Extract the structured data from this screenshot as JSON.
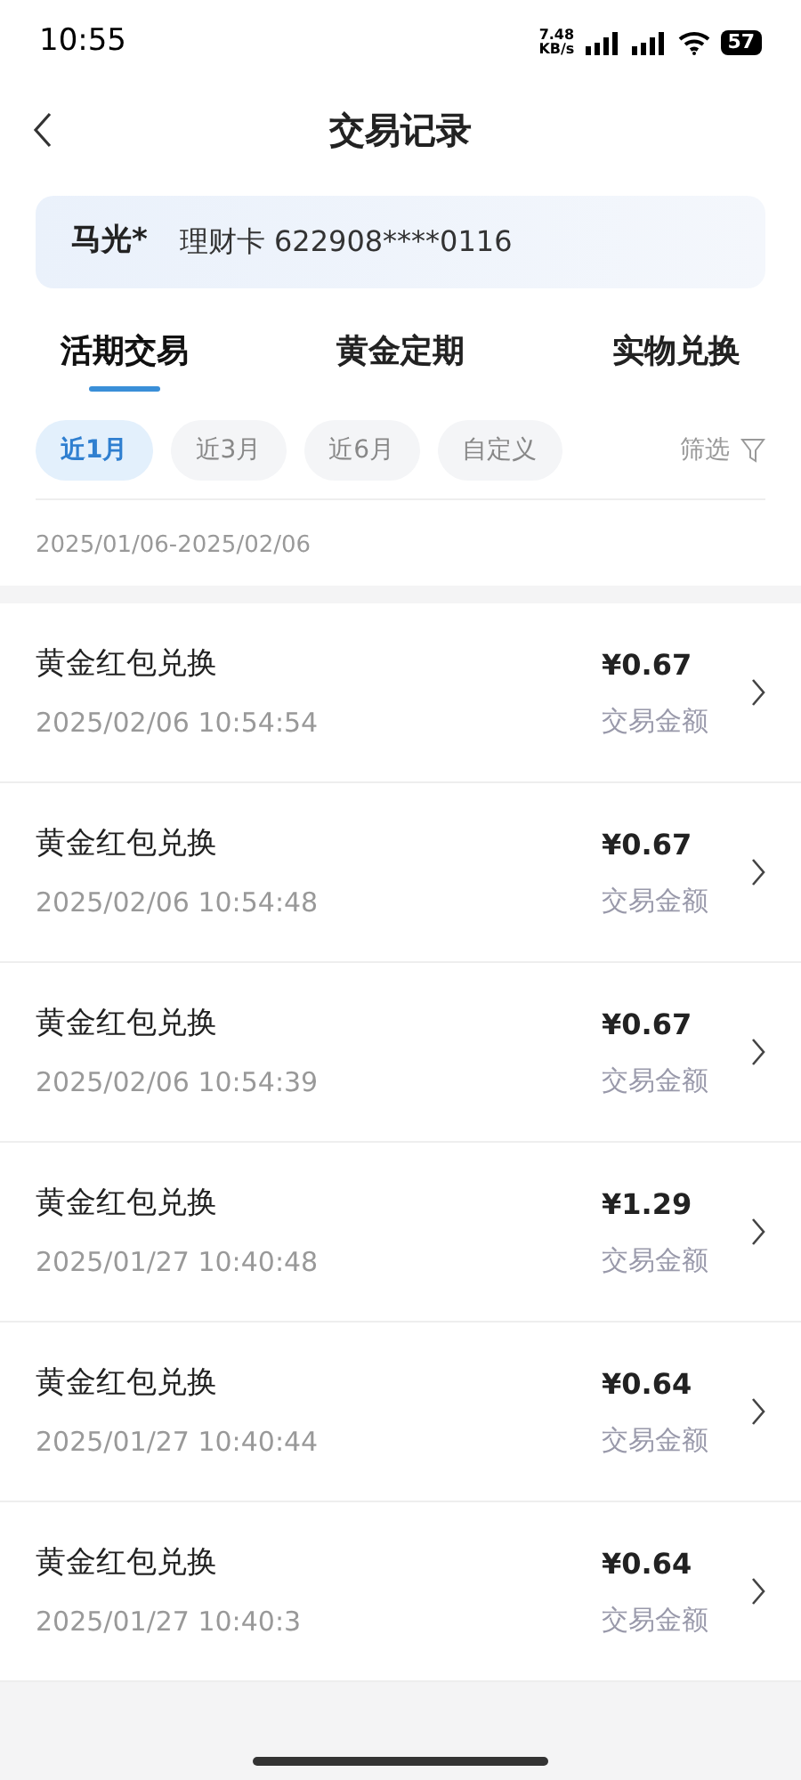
{
  "status_bar": {
    "time": "10:55",
    "speed": "7.48",
    "speed_unit": "KB/s",
    "battery": "57"
  },
  "header": {
    "title": "交易记录"
  },
  "account": {
    "name": "马光*",
    "card": "理财卡 622908****0116"
  },
  "tabs": [
    {
      "label": "活期交易",
      "selected": true
    },
    {
      "label": "黄金定期",
      "selected": false
    },
    {
      "label": "实物兑换",
      "selected": false
    }
  ],
  "periods": [
    {
      "label": "近1月",
      "selected": true
    },
    {
      "label": "近3月",
      "selected": false
    },
    {
      "label": "近6月",
      "selected": false
    },
    {
      "label": "自定义",
      "selected": false
    }
  ],
  "filter": {
    "label": "筛选"
  },
  "date_range": "2025/01/06-2025/02/06",
  "transactions": [
    {
      "title": "黄金红包兑换",
      "time": "2025/02/06 10:54:54",
      "amount": "¥0.67",
      "amount_label": "交易金额"
    },
    {
      "title": "黄金红包兑换",
      "time": "2025/02/06 10:54:48",
      "amount": "¥0.67",
      "amount_label": "交易金额"
    },
    {
      "title": "黄金红包兑换",
      "time": "2025/02/06 10:54:39",
      "amount": "¥0.67",
      "amount_label": "交易金额"
    },
    {
      "title": "黄金红包兑换",
      "time": "2025/01/27 10:40:48",
      "amount": "¥1.29",
      "amount_label": "交易金额"
    },
    {
      "title": "黄金红包兑换",
      "time": "2025/01/27 10:40:44",
      "amount": "¥0.64",
      "amount_label": "交易金额"
    },
    {
      "title": "黄金红包兑换",
      "time": "2025/01/27 10:40:3",
      "amount": "¥0.64",
      "amount_label": "交易金额"
    }
  ]
}
